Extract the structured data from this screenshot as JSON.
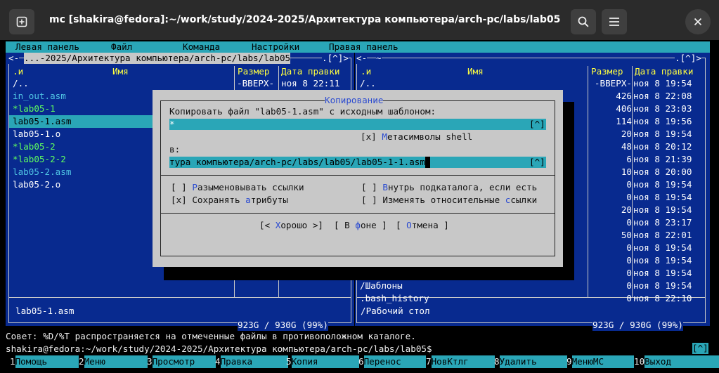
{
  "window": {
    "title": "mc [shakira@fedora]:~/work/study/2024-2025/Архитектура компьютера/arch-pc/labs/lab05",
    "new_tab_icon": "plus-square-icon",
    "search_icon": "search-icon",
    "menu_icon": "hamburger-icon",
    "close_icon": "close-icon"
  },
  "menubar": [
    "Левая панель",
    "Файл",
    "Команда",
    "Настройки",
    "Правая панель"
  ],
  "left_panel": {
    "path": " ...-2025/Архитектура компьютера/arch-pc/labs/lab05 ",
    "top_right": ".[^]>",
    "corner": "<-",
    "hdr_sort": ".и",
    "hdr_name": "Имя",
    "hdr_size": "Размер",
    "hdr_date": "Дата правки",
    "files": [
      {
        "name": "/..",
        "size": "-ВВЕРХ-",
        "date": "ноя  8 22:11",
        "kind": "dir"
      },
      {
        "name": " in_out.asm",
        "kind": "src"
      },
      {
        "name": "*lab05-1",
        "kind": "exe"
      },
      {
        "name": " lab05-1.asm",
        "kind": "sel"
      },
      {
        "name": " lab05-1.o",
        "kind": "dir"
      },
      {
        "name": "*lab05-2",
        "kind": "exe"
      },
      {
        "name": "*lab05-2-2",
        "kind": "exe"
      },
      {
        "name": " lab05-2.asm",
        "kind": "src"
      },
      {
        "name": " lab05-2.o",
        "kind": "dir"
      }
    ],
    "footer_name": " lab05-1.asm",
    "disk": " 923G / 930G (99%) "
  },
  "right_panel": {
    "path": "~",
    "top_right": ".[^]>",
    "corner": "<-",
    "hdr_sort": ".и",
    "hdr_name": "Имя",
    "hdr_size": "Размер",
    "hdr_date": "Дата правки",
    "files": [
      {
        "name": "/..",
        "size": "-ВВЕРХ-",
        "date": "ноя  8 19:54"
      },
      {
        "name": "",
        "size": "426",
        "date": "ноя  8 22:08"
      },
      {
        "name": "",
        "size": "406",
        "date": "ноя  8 23:03"
      },
      {
        "name": "",
        "size": "114",
        "date": "ноя  8 19:56"
      },
      {
        "name": "",
        "size": "20",
        "date": "ноя  8 19:54"
      },
      {
        "name": "",
        "size": "48",
        "date": "ноя  8 20:12"
      },
      {
        "name": "",
        "size": "6",
        "date": "ноя  8 21:39"
      },
      {
        "name": "",
        "size": "10",
        "date": "ноя  8 20:00"
      },
      {
        "name": "",
        "size": "0",
        "date": "ноя  8 19:54"
      },
      {
        "name": "",
        "size": "0",
        "date": "ноя  8 19:54"
      },
      {
        "name": "",
        "size": "20",
        "date": "ноя  8 19:54"
      },
      {
        "name": "",
        "size": "0",
        "date": "ноя  8 23:17"
      },
      {
        "name": "",
        "size": "50",
        "date": "ноя  8 22:01"
      },
      {
        "name": "",
        "size": "0",
        "date": "ноя  8 19:54"
      },
      {
        "name": "",
        "size": "0",
        "date": "ноя  8 19:54"
      },
      {
        "name": "",
        "size": "0",
        "date": "ноя  8 19:54"
      },
      {
        "name": "/Шаблоны",
        "size": "0",
        "date": "ноя  8 19:54"
      },
      {
        "name": " .bash_history",
        "size": "0",
        "date": "ноя  8 22:10"
      }
    ],
    "footer_name": "/Рабочий стол",
    "disk": " 923G / 930G (99%) "
  },
  "dialog": {
    "title": " Копирование ",
    "prompt": "Копировать файл \"lab05-1.asm\" с исходным шаблоном:",
    "source_value": "*",
    "hist_btn": "[^]",
    "metachar": {
      "box": "[x]",
      "hot": "М",
      "rest": "етасимволы shell"
    },
    "to_label": "в:",
    "dest_value": "тура компьютера/arch-pc/labs/lab05/lab05-1-1.asm",
    "opt_deref": {
      "box": "[ ]",
      "hot": "Р",
      "rest": "азыменовывать ссылки"
    },
    "opt_attrs": {
      "box": "[x]",
      "pre": "Сохранять ",
      "hot": "а",
      "rest": "трибуты"
    },
    "opt_into": {
      "box": "[ ]",
      "hot": "В",
      "rest": "нутрь подкаталога, если есть"
    },
    "opt_rel": {
      "box": "[ ]",
      "pre": "Изменять относительные ",
      "hot": "с",
      "rest": "сылки"
    },
    "btn_ok": {
      "pre": "[< ",
      "hot": "Х",
      "rest": "орошо >]"
    },
    "btn_bg": {
      "pre": "[ В ",
      "hot": "ф",
      "rest": "оне ]"
    },
    "btn_cancel": {
      "pre": "[ ",
      "hot": "О",
      "rest": "тмена ]"
    }
  },
  "hint": "Совет: %D/%T распространяется на отмеченные файлы в противоположном каталоге.",
  "prompt": "shakira@fedora:~/work/study/2024-2025/Архитектура компьютера/arch-pc/labs/lab05$",
  "prompt_hist": "[^]",
  "fkeys": [
    {
      "n": "1",
      "label": "Помощь"
    },
    {
      "n": "2",
      "label": "Меню"
    },
    {
      "n": "3",
      "label": "Просмотр"
    },
    {
      "n": "4",
      "label": "Правка"
    },
    {
      "n": "5",
      "label": "Копия"
    },
    {
      "n": "6",
      "label": "Перенос"
    },
    {
      "n": "7",
      "label": "НовКтлг"
    },
    {
      "n": "8",
      "label": "Удалить"
    },
    {
      "n": "9",
      "label": "МенюМС"
    },
    {
      "n": "10",
      "label": "Выход"
    }
  ],
  "colors": {
    "panel": "#082a8f",
    "accent": "#2aa6b7",
    "dialog": "#c8c8c8",
    "exec": "#5fff5f",
    "header": "#ffff40"
  }
}
